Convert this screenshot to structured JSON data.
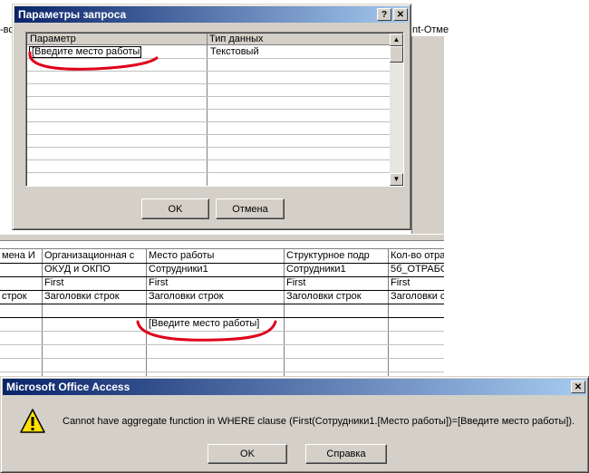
{
  "background_tabs": {
    "left_fragment": "-вс",
    "right_fragment": "nt-Отме"
  },
  "param_dialog": {
    "title": "Параметры запроса",
    "help_symbol": "?",
    "close_symbol": "✕",
    "columns": [
      "Параметр",
      "Тип данных"
    ],
    "rows": [
      {
        "param": "[Введите место работы]",
        "type": "Текстовый"
      }
    ],
    "ok_label": "OK",
    "cancel_label": "Отмена"
  },
  "design_grid": {
    "rows": [
      [
        "мена И",
        "Организационная с",
        "Место работы",
        "Структурное подр",
        "Кол-во отра"
      ],
      [
        "ОКУД и ОКПО",
        "Сотрудники1",
        "Сотрудники1",
        "5б_ОТРАБО"
      ],
      [
        "First",
        "First",
        "First",
        "First"
      ],
      [
        "строк",
        "Заголовки строк",
        "Заголовки строк",
        "Заголовки строк",
        "Заголовки с"
      ],
      [],
      [
        "[Введите место работы]"
      ]
    ]
  },
  "error_dialog": {
    "title": "Microsoft Office Access",
    "close_symbol": "✕",
    "warning_icon": "warning-icon",
    "message": "Cannot have aggregate function in WHERE clause (First(Сотрудники1.[Место работы])=[Введите место работы]).",
    "ok_label": "OK",
    "help_label": "Справка"
  },
  "colors": {
    "title_dark": "#0a246a",
    "title_light": "#a6caf0",
    "face": "#d4d0c8",
    "annotation": "#e0001a"
  }
}
